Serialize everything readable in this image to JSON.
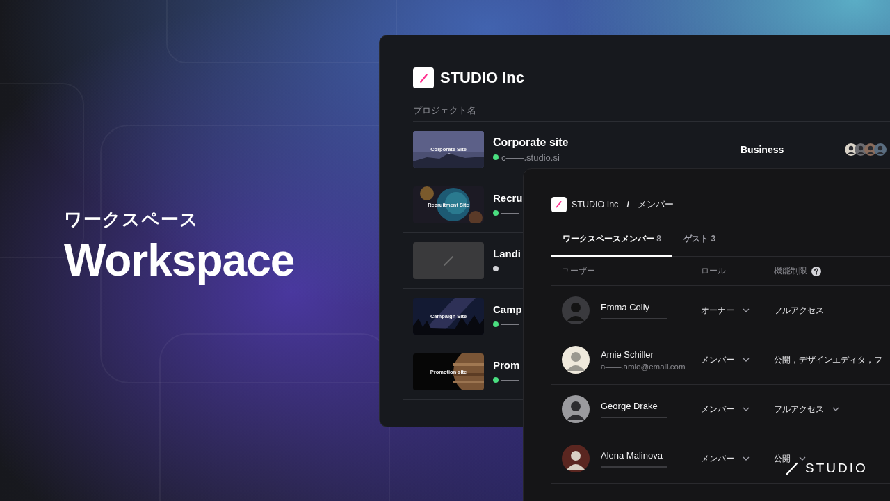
{
  "hero": {
    "subtitle": "ワークスペース",
    "title": "Workspace"
  },
  "projects_panel": {
    "workspace_name": "STUDIO Inc",
    "column_header": "プロジェクト名",
    "projects": [
      {
        "title": "Corporate site",
        "thumbnail": {
          "kind": "picture",
          "label": "Corporate Site"
        },
        "color": "#4ade80",
        "url": "c——.studio.si",
        "plan": "Business"
      },
      {
        "title": "Recru",
        "thumbnail": {
          "kind": "picture",
          "label": "Recruitment Site"
        },
        "color": "#4ade80",
        "url": "——"
      },
      {
        "title": "Landi",
        "thumbnail": {
          "kind": "placeholder"
        },
        "color": "#d4d4d8",
        "url": "——"
      },
      {
        "title": "Camp",
        "thumbnail": {
          "kind": "picture",
          "label": "Campaign Site"
        },
        "color": "#4ade80",
        "url": "——"
      },
      {
        "title": "Prom",
        "thumbnail": {
          "kind": "picture",
          "label": "Promotion site"
        },
        "color": "#4ade80",
        "url": "——"
      }
    ]
  },
  "members_panel": {
    "breadcrumb": {
      "workspace": "STUDIO Inc",
      "separator": "/",
      "page": "メンバー"
    },
    "tabs": [
      {
        "label": "ワークスペースメンバー",
        "count": "8",
        "selected": true
      },
      {
        "label": "ゲスト",
        "count": "3",
        "selected": false
      }
    ],
    "columns": [
      {
        "label": "ユーザー",
        "help": false
      },
      {
        "label": "ロール",
        "help": false
      },
      {
        "label": "機能制限",
        "help": true
      }
    ],
    "members": [
      {
        "name": "Emma Colly",
        "role": "オーナー",
        "permissions": "フルアクセス",
        "permissions_dropdown": false
      },
      {
        "name": "Amie Schiller",
        "email": "a——.amie@email.com",
        "role": "メンバー",
        "permissions": "公開，デザインエディタ，フ",
        "permissions_dropdown": false
      },
      {
        "name": "George Drake",
        "role": "メンバー",
        "permissions": "フルアクセス",
        "permissions_dropdown": true
      },
      {
        "name": "Alena Malinova",
        "role": "メンバー",
        "permissions": "公開",
        "permissions_dropdown": true
      }
    ]
  },
  "brand": {
    "logo_text": "STUDIO"
  }
}
